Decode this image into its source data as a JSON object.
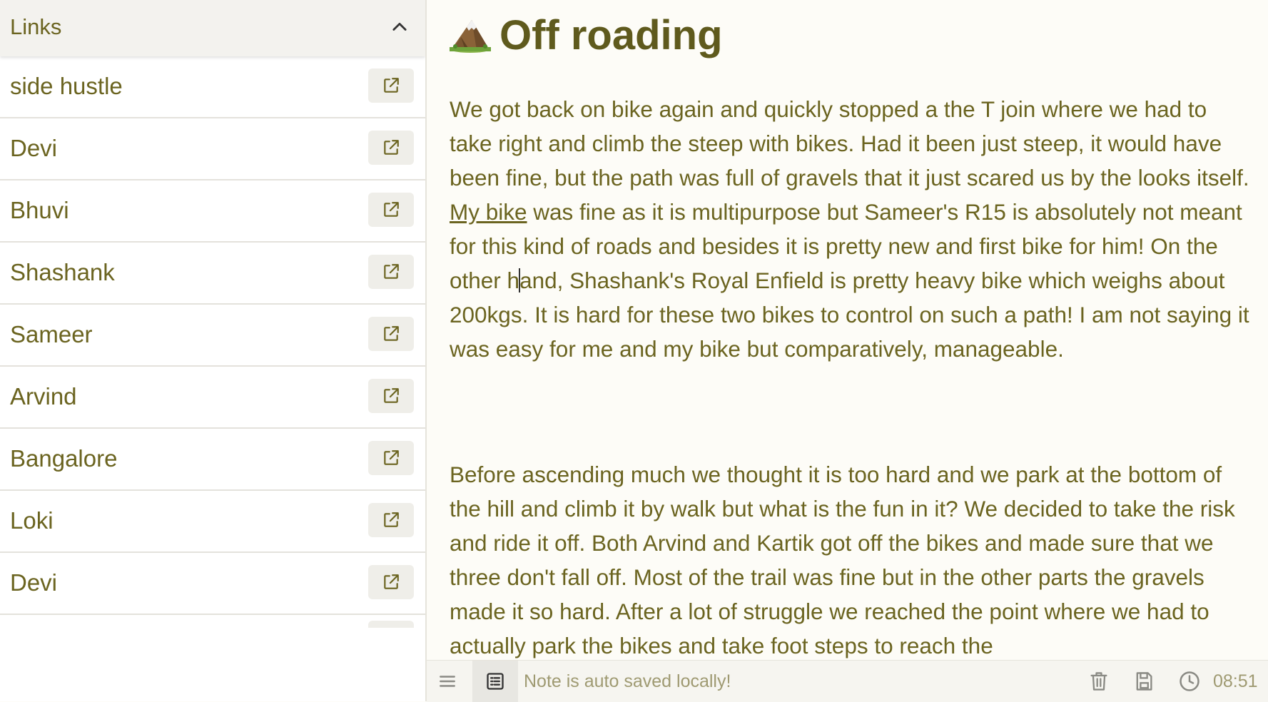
{
  "sidebar": {
    "title": "Links",
    "items": [
      {
        "label": "side hustle"
      },
      {
        "label": "Devi"
      },
      {
        "label": "Bhuvi"
      },
      {
        "label": "Shashank"
      },
      {
        "label": "Sameer"
      },
      {
        "label": "Arvind"
      },
      {
        "label": "Bangalore"
      },
      {
        "label": "Loki"
      },
      {
        "label": "Devi"
      }
    ]
  },
  "note": {
    "title_icon": "mountain-emoji",
    "title": "Off roading",
    "p1": {
      "before_link": "We got back on bike again and quickly stopped a the T join where we had to take right and climb the steep with bikes. Had it been just steep, it would have been fine, but the path was full of gravels that it just scared us by the looks itself. ",
      "link": "My bike",
      "after_link_pre_caret": " was fine as it is multipurpose but Sameer's R15 is absolutely not meant for this kind of roads and besides it is pretty new and first bike for him! On the other h",
      "after_caret": "and, Shashank's Royal Enfield is pretty heavy bike which weighs about 200kgs. It is hard for these two bikes to control on such a path! I am not saying it was easy for me and my bike but comparatively, manageable."
    },
    "p2": "Before ascending much we thought it is too hard and we park at the bottom of the hill and climb it by walk but what is the fun in it? We decided to take the risk and ride it off. Both Arvind and Kartik got off the bikes and made sure that we three don't fall off. Most of the trail was fine but in the other parts the gravels made it so hard. After a lot of struggle we reached the point where we had to actually park the bikes and take foot steps to reach the"
  },
  "footer": {
    "status": "Note is auto saved locally!",
    "time": "08:51",
    "icons": [
      "menu-icon",
      "list-view-icon",
      "trash-icon",
      "save-icon",
      "clock-icon"
    ]
  },
  "colors": {
    "text": "#6b6420",
    "title": "#5f5a1d",
    "muted": "#9f9a72",
    "background": "#fdfcf7"
  }
}
